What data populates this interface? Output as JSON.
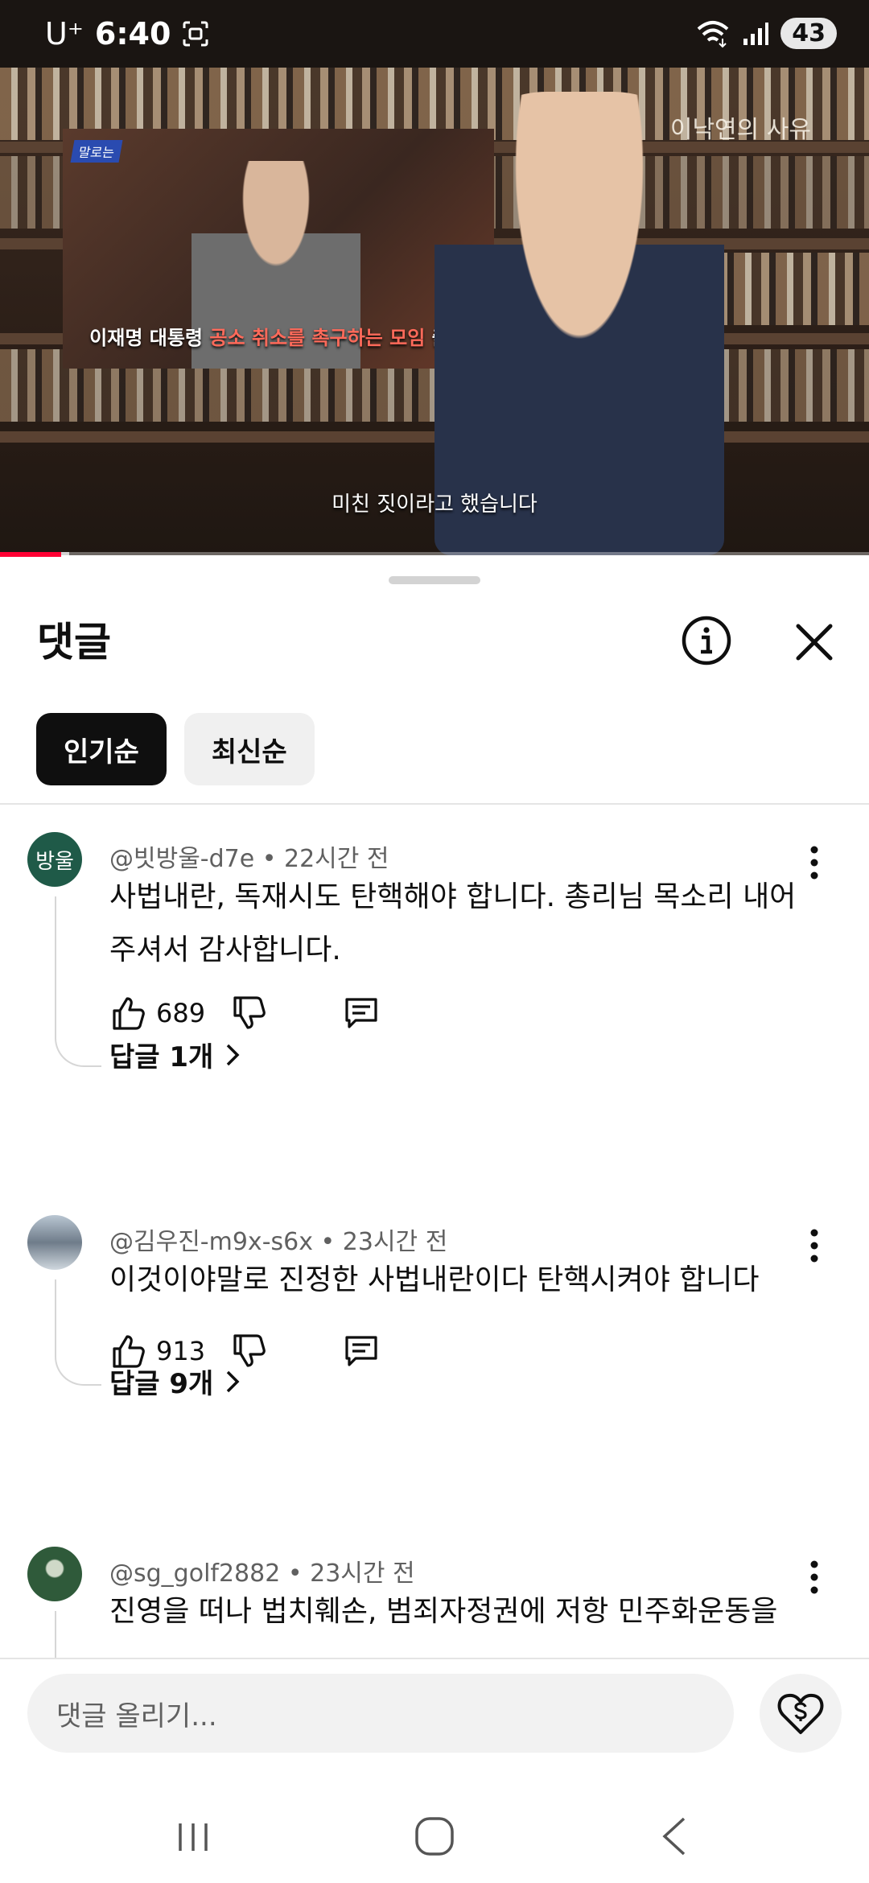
{
  "status_bar": {
    "carrier": "U⁺",
    "time": "6:40",
    "battery": "43"
  },
  "video": {
    "channel_logo": "이낙연의 사유",
    "inset_tag": "말로는",
    "inset_caption_part1": "이재명 대통령 ",
    "inset_caption_highlight": "공소 취소를 촉구하는 모임",
    "inset_caption_part2": " 출범",
    "subtitle": "미친 짓이라고 했습니다",
    "progress_played_fraction": 0.07,
    "progress_buffered_fraction": 0.08
  },
  "comments_panel": {
    "title": "댓글",
    "sort_chips": [
      {
        "label": "인기순",
        "active": true
      },
      {
        "label": "최신순",
        "active": false
      }
    ],
    "comments": [
      {
        "avatar_text": "방울",
        "avatar_color": "#1f5a48",
        "author": "@빗방울-d7e",
        "time": "22시간 전",
        "text": "사법내란, 독재시도 탄핵해야 합니다. 총리님 목소리 내어 주셔서 감사합니다.",
        "likes": "689",
        "replies": "답글 1개"
      },
      {
        "avatar_text": "",
        "avatar_color": "#6f7c8a",
        "author": "@김우진-m9x-s6x",
        "time": "23시간 전",
        "text": "이것이야말로 진정한 사법내란이다 탄핵시켜야 합니다",
        "likes": "913",
        "replies": "답글 9개"
      },
      {
        "avatar_text": "",
        "avatar_color": "#2f5a3a",
        "author": "@sg_golf2882",
        "time": "23시간 전",
        "text": "진영을 떠나 법치훼손, 범죄자정권에 저항  민주화운동을"
      }
    ],
    "composer_placeholder": "댓글 올리기..."
  },
  "colors": {
    "accent_red": "#ff0033",
    "text_primary": "#0f0f0f",
    "text_secondary": "#606060"
  }
}
